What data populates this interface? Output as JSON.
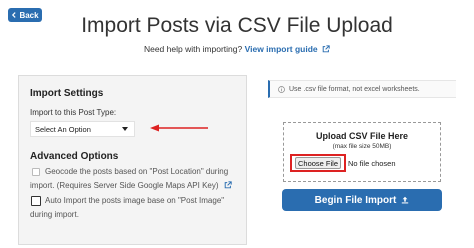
{
  "back": {
    "label": "Back",
    "icon": "chevron-left-icon"
  },
  "title": "Import Posts via CSV File Upload",
  "help": {
    "text": "Need help with importing?",
    "link": "View import guide",
    "icon": "external-link-icon"
  },
  "import_settings": {
    "title": "Import Settings",
    "post_type_label": "Import to this Post Type:",
    "post_type_selected": "Select An Option"
  },
  "advanced": {
    "title": "Advanced Options",
    "geocode": {
      "line1": "Geocode the posts based on \"Post Location\" during",
      "line2": "import. (Requires Server Side Google Maps API Key)"
    },
    "auto_image": {
      "line1": "Auto Import the posts image base on \"Post Image\"",
      "line2": "during import."
    }
  },
  "info": {
    "text": "Use .csv file format, not excel worksheets.",
    "icon": "info-icon"
  },
  "upload": {
    "title": "Upload CSV File Here",
    "subtitle": "(max file size 50MB)",
    "choose_label": "Choose File",
    "no_file": "No file chosen"
  },
  "begin": {
    "label": "Begin File Import",
    "icon": "upload-icon"
  },
  "colors": {
    "accent": "#2a6db0",
    "highlight": "#dd2222",
    "panel_bg": "#f4f4f4"
  }
}
